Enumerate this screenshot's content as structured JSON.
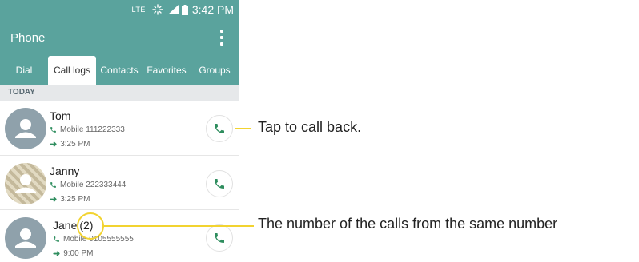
{
  "status_bar": {
    "network": "LTE",
    "time": "3:42 PM"
  },
  "app_bar": {
    "title": "Phone"
  },
  "tabs": [
    {
      "label": "Dial"
    },
    {
      "label": "Call logs",
      "selected": true
    },
    {
      "label": "Contacts"
    },
    {
      "label": "Favorites"
    },
    {
      "label": "Groups"
    }
  ],
  "section_header": "TODAY",
  "calls": [
    {
      "name": "Tom",
      "detail": "Mobile 111222333",
      "time": "3:25 PM",
      "avatar": "default-contact"
    },
    {
      "name": "Janny",
      "detail": "Mobile 222333444",
      "time": "3:25 PM",
      "avatar": "photo-contact"
    },
    {
      "name": "Jane",
      "count": "(2)",
      "detail": "Mobile 0105555555",
      "time": "9:00 PM",
      "avatar": "default-contact"
    }
  ],
  "callouts": {
    "call_back": "Tap to call back.",
    "call_count": "The number of the calls from the same number"
  },
  "colors": {
    "header_teal": "#5aa39d",
    "call_green": "#2e8d5e",
    "callout_yellow": "#f2d330"
  },
  "icons": [
    "sync-icon",
    "signal-icon",
    "battery-icon",
    "more-options-icon",
    "contact-avatar-icon",
    "phone-handset-icon",
    "outgoing-arrow-icon"
  ]
}
